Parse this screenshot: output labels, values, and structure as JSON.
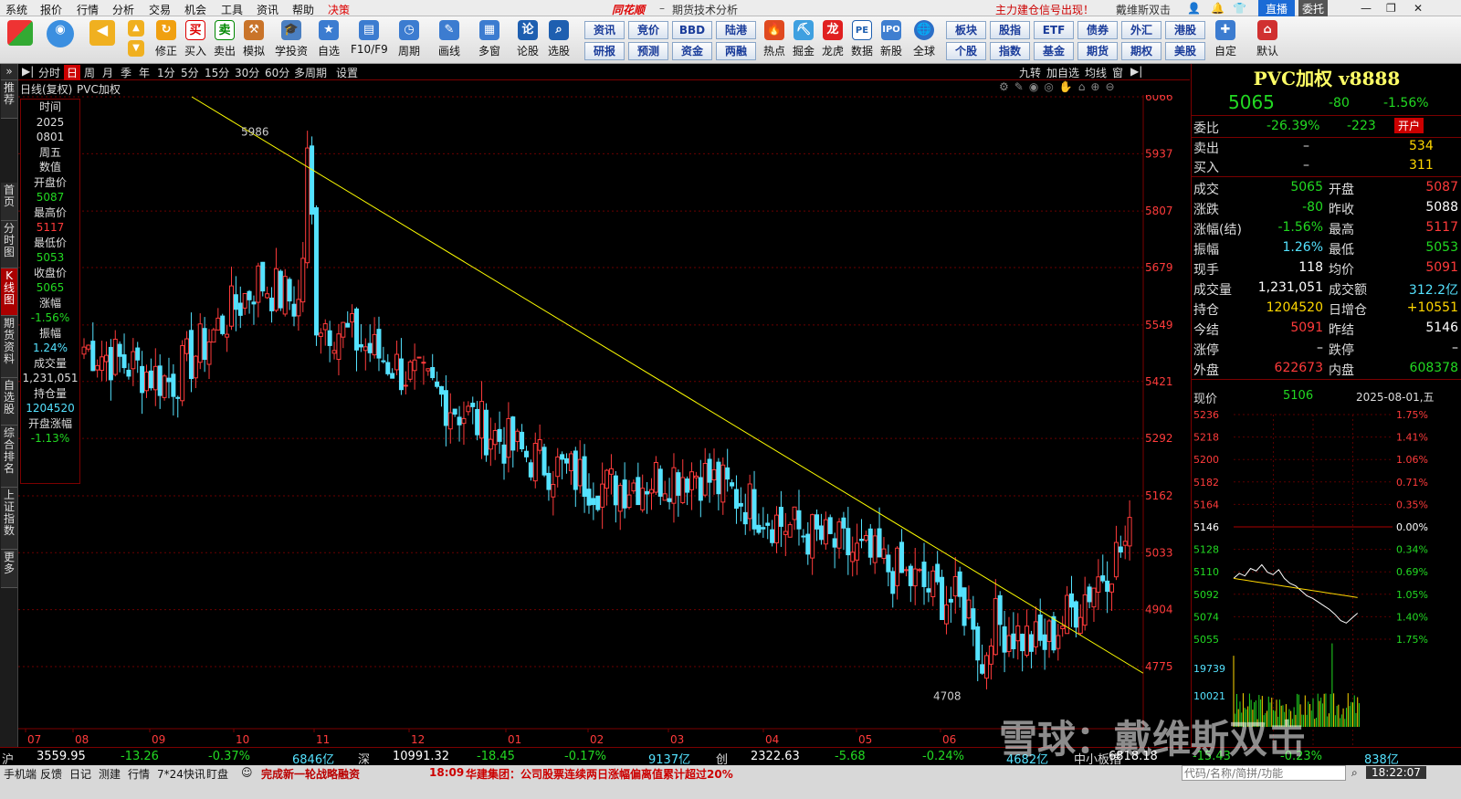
{
  "menu": {
    "items": [
      "系统",
      "报价",
      "行情",
      "分析",
      "交易",
      "机会",
      "工具",
      "资讯",
      "帮助",
      "决策"
    ],
    "app_logo": "同花顺",
    "window_title": "期货技术分析",
    "promo_text": "主力建仓信号出现！",
    "account_name": "戴维斯双击",
    "live_button": "直播",
    "delegate_button": "委托"
  },
  "toolbar": {
    "buttons": [
      "修正",
      "买入",
      "卖出",
      "模拟",
      "学投资",
      "自选",
      "F10/F9",
      "周期",
      "画线",
      "多窗",
      "论股",
      "选股"
    ],
    "quick_buttons": [
      [
        "资讯",
        "竞价",
        "BBD",
        "陆港"
      ],
      [
        "研报",
        "预测",
        "资金",
        "两融"
      ]
    ],
    "buttons2": [
      "热点",
      "掘金",
      "龙虎",
      "数据",
      "新股",
      "全球"
    ],
    "quick_buttons2": [
      [
        "板块",
        "股指",
        "ETF",
        "债券",
        "外汇",
        "港股"
      ],
      [
        "个股",
        "指数",
        "基金",
        "期货",
        "期权",
        "美股"
      ]
    ],
    "buttons3": [
      "自定",
      "默认"
    ]
  },
  "periods": {
    "items": [
      "分时",
      "日",
      "周",
      "月",
      "季",
      "年",
      "1分",
      "5分",
      "15分",
      "30分",
      "60分",
      "多周期",
      "设置"
    ],
    "active": "日",
    "right_items": [
      "九转",
      "加自选",
      "均线",
      "窗"
    ]
  },
  "left_tabs": [
    "推荐",
    "首页",
    "分时图",
    "K线图",
    "期货资料",
    "自选股",
    "综合排名",
    "上证指数",
    "更多"
  ],
  "chart": {
    "label_left": "日线(复权)",
    "label_symbol": "PVC加权",
    "high_marker": "5986",
    "low_marker": "4708",
    "price_ticks": [
      "6066",
      "5937",
      "5807",
      "5679",
      "5549",
      "5421",
      "5292",
      "5162",
      "5033",
      "4904",
      "4775"
    ],
    "month_ticks": [
      "07",
      "08",
      "09",
      "10",
      "11",
      "12",
      "01",
      "02",
      "03",
      "04",
      "05",
      "06"
    ]
  },
  "chart_data": {
    "type": "candlestick",
    "title": "",
    "y_range": [
      4708,
      6066
    ],
    "x_categories": [
      "07",
      "08",
      "09",
      "10",
      "11",
      "12",
      "01",
      "02",
      "03",
      "04",
      "05",
      "06",
      "07"
    ],
    "approx_close_by_month": [
      5500,
      5420,
      5650,
      5530,
      5400,
      5260,
      5180,
      5220,
      5100,
      5020,
      4920,
      4820,
      5065
    ],
    "trendline": {
      "from": {
        "label": "2024-09",
        "value": 6066
      },
      "to": {
        "label": "2025-07",
        "value": 4800
      },
      "color": "#ffff00"
    },
    "extremes": {
      "high": 5986,
      "low": 4708
    }
  },
  "infobox": [
    {
      "label": "时间",
      "value": "2025"
    },
    {
      "label": "",
      "value": "0801"
    },
    {
      "label": "",
      "value": "周五"
    },
    {
      "label": "数值",
      "value": ""
    },
    {
      "label": "开盘价",
      "value": "5087"
    },
    {
      "label": "最高价",
      "value": "5117"
    },
    {
      "label": "最低价",
      "value": "5053"
    },
    {
      "label": "收盘价",
      "value": "5065"
    },
    {
      "label": "涨幅",
      "value": "-1.56%"
    },
    {
      "label": "振幅",
      "value": "1.24%"
    },
    {
      "label": "成交量",
      "value": "1,231,051"
    },
    {
      "label": "持仓量",
      "value": "1204520"
    },
    {
      "label": "开盘涨幅",
      "value": "-1.13%"
    }
  ],
  "quote": {
    "title": "PVC加权 v8888",
    "price": "5065",
    "change": "-80",
    "change_pct": "-1.56%",
    "weibi_label": "委比",
    "weibi": "-26.39%",
    "weicha": "-223",
    "open_button": "开户",
    "sell_label": "卖出",
    "sell_price": "–",
    "sell_vol": "534",
    "buy_label": "买入",
    "buy_price": "–",
    "buy_vol": "311",
    "rows": [
      [
        "成交",
        "5065",
        "开盘",
        "5087"
      ],
      [
        "涨跌",
        "-80",
        "昨收",
        "5088"
      ],
      [
        "涨幅(结)",
        "-1.56%",
        "最高",
        "5117"
      ],
      [
        "振幅",
        "1.26%",
        "最低",
        "5053"
      ],
      [
        "现手",
        "118",
        "均价",
        "5091"
      ],
      [
        "成交量",
        "1,231,051",
        "成交额",
        "312.2亿"
      ],
      [
        "持仓",
        "1204520",
        "日增仓",
        "+10551"
      ],
      [
        "今结",
        "5091",
        "昨结",
        "5146"
      ],
      [
        "涨停",
        "–",
        "跌停",
        "–"
      ],
      [
        "外盘",
        "622673",
        "内盘",
        "608378"
      ]
    ]
  },
  "mini": {
    "label": "现价",
    "price": "5106",
    "date": "2025-08-01,五",
    "prices": [
      "5236",
      "5218",
      "5200",
      "5182",
      "5164",
      "5146",
      "5128",
      "5110",
      "5092",
      "5074",
      "5055"
    ],
    "pcts": [
      "1.75%",
      "1.41%",
      "1.06%",
      "0.71%",
      "0.35%",
      "0.00%",
      "0.34%",
      "0.69%",
      "1.05%",
      "1.40%",
      "1.75%"
    ],
    "vol_labels": [
      "19739",
      "10021"
    ],
    "intraday": [
      5104,
      5108,
      5106,
      5112,
      5110,
      5115,
      5109,
      5107,
      5111,
      5104,
      5100,
      5098,
      5094,
      5090,
      5088,
      5085,
      5082,
      5079,
      5075,
      5070,
      5068,
      5072,
      5076
    ]
  },
  "status": {
    "items": [
      {
        "name": "沪",
        "value": "3559.95",
        "chg": "-13.26",
        "pct": "-0.37%",
        "amt": "6846亿"
      },
      {
        "name": "深",
        "value": "10991.32",
        "chg": "-18.45",
        "pct": "-0.17%",
        "amt": "9137亿"
      },
      {
        "name": "创",
        "value": "2322.63",
        "chg": "-5.68",
        "pct": "-0.24%",
        "amt": "4682亿"
      },
      {
        "name": "中小板指",
        "value": "6818.18",
        "chg": "-15.43",
        "pct": "-0.23%",
        "amt": "838亿"
      }
    ]
  },
  "bottom": {
    "items": [
      "手机端",
      "反馈",
      "日记",
      "测建",
      "行情",
      "7*24快讯",
      "盯盘"
    ],
    "news1": "完成新一轮战略融资",
    "news_time": "18:09",
    "news2": "华建集团：公司股票连续两日涨幅偏离值累计超过20%",
    "search_placeholder": "代码/名称/简拼/功能",
    "clock": "18:22:07"
  },
  "watermark": "雪球：戴维斯双击"
}
